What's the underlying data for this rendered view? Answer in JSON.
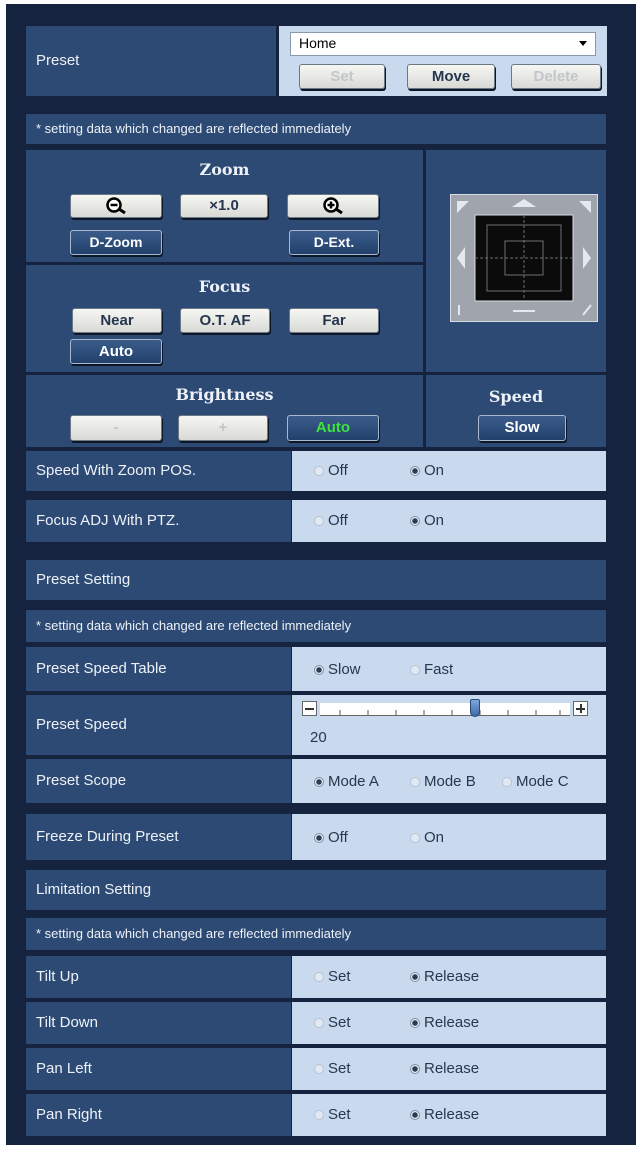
{
  "preset": {
    "label": "Preset",
    "selected": "Home",
    "set_label": "Set",
    "move_label": "Move",
    "delete_label": "Delete"
  },
  "note": "* setting data which changed are reflected immediately",
  "zoom": {
    "title": "Zoom",
    "zoom_value": "×1.0",
    "dzoom_label": "D-Zoom",
    "dext_label": "D-Ext."
  },
  "focus": {
    "title": "Focus",
    "near_label": "Near",
    "otaf_label": "O.T. AF",
    "far_label": "Far",
    "auto_label": "Auto"
  },
  "brightness": {
    "title": "Brightness",
    "minus_label": "-",
    "plus_label": "+",
    "auto_label": "Auto"
  },
  "speed": {
    "title": "Speed",
    "value_label": "Slow"
  },
  "rows_top": [
    {
      "label": "Speed With Zoom POS.",
      "options": [
        "Off",
        "On"
      ],
      "selected": "On"
    },
    {
      "label": "Focus ADJ With PTZ.",
      "options": [
        "Off",
        "On"
      ],
      "selected": "On"
    }
  ],
  "preset_setting": {
    "title": "Preset Setting",
    "note": "* setting data which changed are reflected immediately",
    "speed_table": {
      "label": "Preset Speed Table",
      "options": [
        "Slow",
        "Fast"
      ],
      "selected": "Slow"
    },
    "speed": {
      "label": "Preset Speed",
      "value": "20",
      "slider_fraction": 0.62
    },
    "scope": {
      "label": "Preset Scope",
      "options": [
        "Mode A",
        "Mode B",
        "Mode C"
      ],
      "selected": "Mode A"
    }
  },
  "freeze": {
    "label": "Freeze During Preset",
    "options": [
      "Off",
      "On"
    ],
    "selected": "Off"
  },
  "limitation": {
    "title": "Limitation Setting",
    "note": "* setting data which changed are reflected immediately",
    "rows": [
      {
        "label": "Tilt Up",
        "options": [
          "Set",
          "Release"
        ],
        "selected": "Release"
      },
      {
        "label": "Tilt Down",
        "options": [
          "Set",
          "Release"
        ],
        "selected": "Release"
      },
      {
        "label": "Pan Left",
        "options": [
          "Set",
          "Release"
        ],
        "selected": "Release"
      },
      {
        "label": "Pan Right",
        "options": [
          "Set",
          "Release"
        ],
        "selected": "Release"
      }
    ]
  }
}
